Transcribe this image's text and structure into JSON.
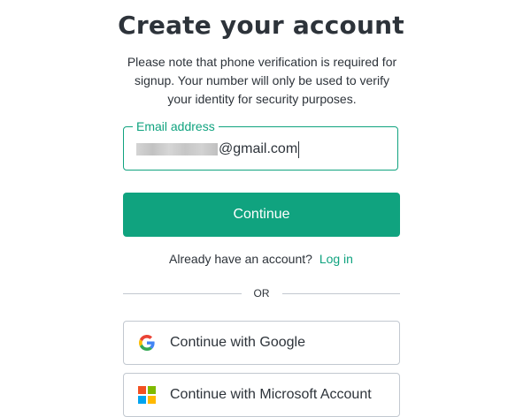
{
  "header": {
    "title": "Create your account",
    "subtitle": "Please note that phone verification is required for signup. Your number will only be used to verify your identity for security purposes."
  },
  "email": {
    "label": "Email address",
    "value_visible": "@gmail.com"
  },
  "continue_button": {
    "label": "Continue"
  },
  "login": {
    "prompt": "Already have an account?",
    "link": "Log in"
  },
  "divider": {
    "label": "OR"
  },
  "social": {
    "google": {
      "label": "Continue with Google",
      "icon": "google-icon"
    },
    "microsoft": {
      "label": "Continue with Microsoft Account",
      "icon": "microsoft-icon"
    }
  },
  "colors": {
    "accent": "#10a37f",
    "text": "#2d333a",
    "border": "#c2c8d0"
  }
}
